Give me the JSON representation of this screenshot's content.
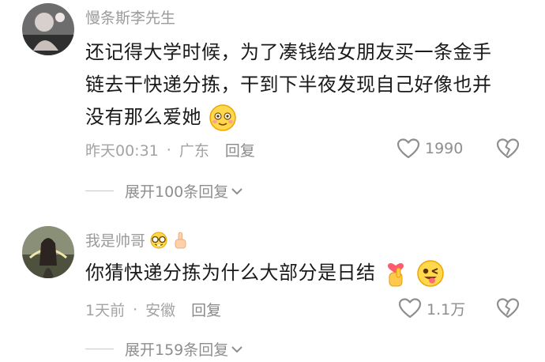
{
  "comments": [
    {
      "username": "慢条斯李先生",
      "lines": [
        "还记得大学时候，为了凑钱给女朋友买一条金手",
        "链去干快递分拣，干到下半夜发现自己好像也并",
        "没有那么爱她"
      ],
      "time": "昨天00:31",
      "location": "广东",
      "reply_label": "回复",
      "likes": "1990",
      "expand_label": "展开100条回复"
    },
    {
      "username": "我是帅哥",
      "lines": [
        "你猜快递分拣为什么大部分是日结"
      ],
      "time": "1天前",
      "location": "安徽",
      "reply_label": "回复",
      "likes": "1.1万",
      "expand_label": "展开159条回复"
    }
  ],
  "separator": "·",
  "colors": {
    "text": "#1a1a1a",
    "muted": "#a3a3a3",
    "icon": "#8e8e8e"
  },
  "icons": [
    "heart-icon",
    "dislike-heart-icon",
    "chevron-down-icon",
    "smiley-emoji",
    "nerd-emoji",
    "pointing-finger-emoji",
    "finger-heart-emoji",
    "winking-tongue-emoji"
  ]
}
